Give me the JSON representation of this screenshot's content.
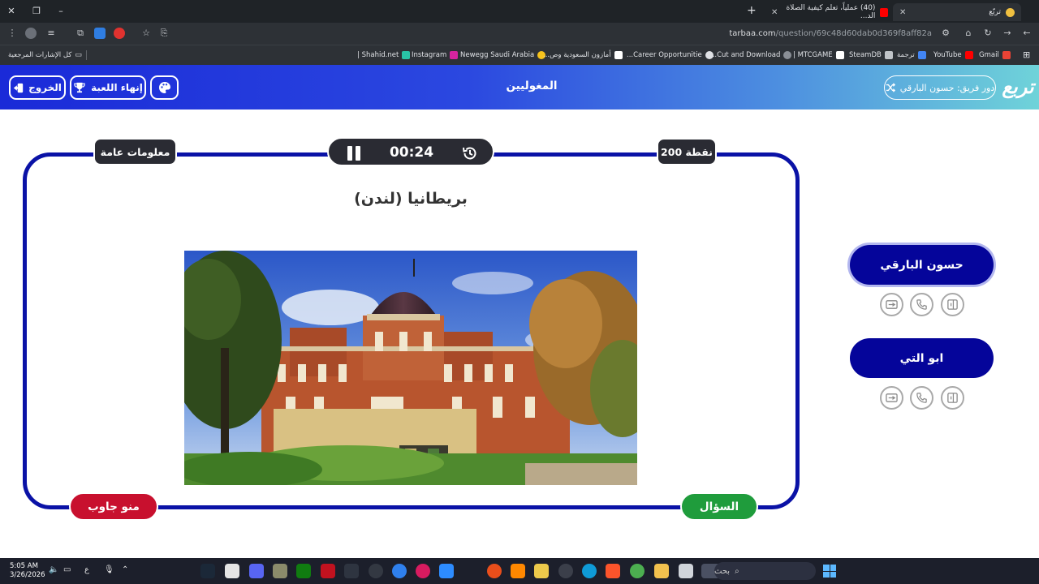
{
  "browser": {
    "tabs": [
      {
        "title": "(40) عملياً، تعلم كيفية الصلاة الد...",
        "active": false
      },
      {
        "title": "تربّع",
        "active": true
      }
    ],
    "url_domain": "tarbaa.com",
    "url_path": "/question/69c48d60dab0d369f8aff82a",
    "bookmarks": [
      "Gmail",
      "YouTube",
      "ترجمة",
      "SteamDB",
      "MTCGAME |",
      "Cut and Download...",
      "Career Opportunitie...",
      "أمازون السعودية وص...",
      "Newegg Saudi Arabia",
      "Instagram",
      "Shahid.net |"
    ],
    "all_bookmarks": "كل الإشارات المرجعية"
  },
  "header": {
    "logo": "تربع",
    "turn_label": "دور فريق: حسون البارقي",
    "title": "المغوليين",
    "end_game": "إنهاء اللعبة",
    "exit": "الخروج"
  },
  "question": {
    "points": "200 نقطة",
    "category": "معلومات عامة",
    "timer": "00:24",
    "answer": "بريطانيا (لندن)",
    "question_button": "السؤال",
    "who_answered_button": "منو جاوب"
  },
  "teams": [
    {
      "name": "حسون البارقي",
      "active": true
    },
    {
      "name": "ابو التي",
      "active": false
    }
  ],
  "taskbar": {
    "time": "5:05 AM",
    "date": "3/26/2026",
    "search": "بحث",
    "lang": "ع"
  },
  "colors": {
    "board_border": "#0a12a6",
    "team_button": "#05059a",
    "question_button": "#1f9c3c",
    "answer_button": "#c8102e",
    "header_start": "#1a2ad8",
    "header_end": "#6fd3d9"
  }
}
